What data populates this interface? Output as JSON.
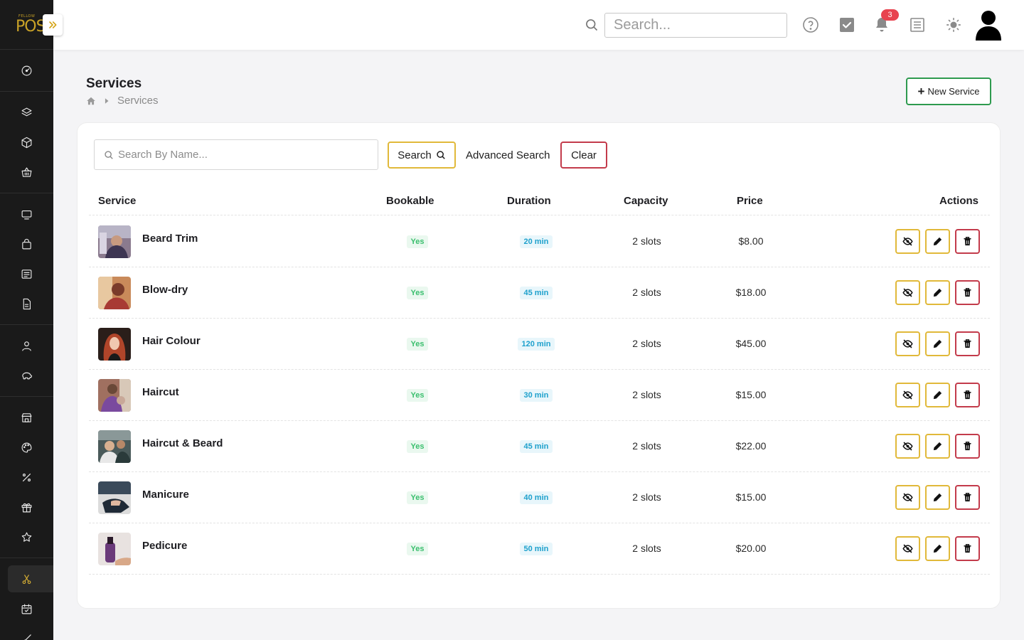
{
  "app": {
    "logo_small": "FELLOW",
    "logo_big": "POS"
  },
  "topbar": {
    "search_placeholder": "Search...",
    "notification_count": "3"
  },
  "page": {
    "title": "Services",
    "breadcrumb_current": "Services",
    "new_button_label": "New Service"
  },
  "filters": {
    "search_placeholder": "Search By Name...",
    "search_button": "Search",
    "advanced_search": "Advanced Search",
    "clear_button": "Clear"
  },
  "table": {
    "headers": {
      "service": "Service",
      "bookable": "Bookable",
      "duration": "Duration",
      "capacity": "Capacity",
      "price": "Price",
      "actions": "Actions"
    },
    "rows": [
      {
        "name": "Beard Trim",
        "bookable": "Yes",
        "duration": "20 min",
        "capacity": "2 slots",
        "price": "$8.00"
      },
      {
        "name": "Blow-dry",
        "bookable": "Yes",
        "duration": "45 min",
        "capacity": "2 slots",
        "price": "$18.00"
      },
      {
        "name": "Hair Colour",
        "bookable": "Yes",
        "duration": "120 min",
        "capacity": "2 slots",
        "price": "$45.00"
      },
      {
        "name": "Haircut",
        "bookable": "Yes",
        "duration": "30 min",
        "capacity": "2 slots",
        "price": "$15.00"
      },
      {
        "name": "Haircut & Beard",
        "bookable": "Yes",
        "duration": "45 min",
        "capacity": "2 slots",
        "price": "$22.00"
      },
      {
        "name": "Manicure",
        "bookable": "Yes",
        "duration": "40 min",
        "capacity": "2 slots",
        "price": "$15.00"
      },
      {
        "name": "Pedicure",
        "bookable": "Yes",
        "duration": "50 min",
        "capacity": "2 slots",
        "price": "$20.00"
      }
    ]
  },
  "colors": {
    "sidebar_bg": "#1a1a1a",
    "accent_yellow": "#e1b93a",
    "accent_red": "#c33b4b",
    "accent_green": "#2e9a4f",
    "badge_red": "#e8434f"
  },
  "sidebar_icons": [
    "dashboard-icon",
    "layers-icon",
    "box-icon",
    "basket-icon",
    "monitor-icon",
    "shopping-bag-icon",
    "list-icon",
    "document-icon",
    "user-icon",
    "piggy-bank-icon",
    "store-icon",
    "palette-icon",
    "percent-icon",
    "gift-icon",
    "star-icon",
    "scissors-icon",
    "calendar-check-icon",
    "brush-icon"
  ]
}
